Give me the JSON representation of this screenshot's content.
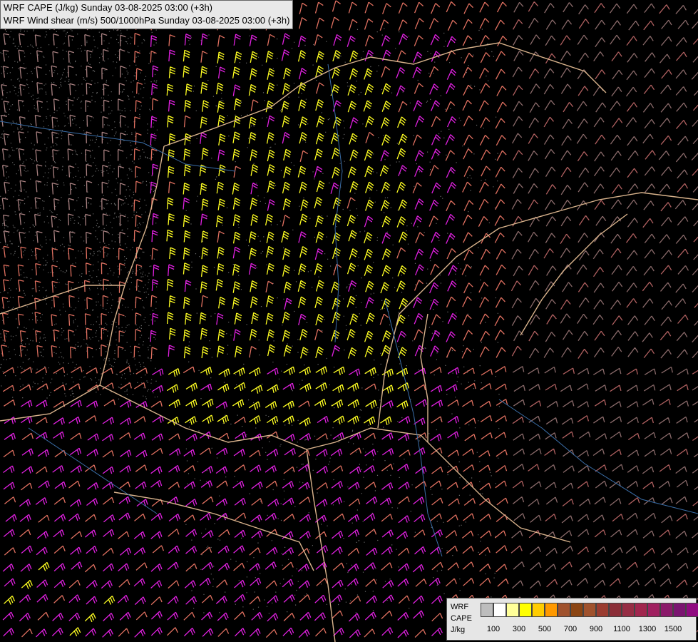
{
  "title": {
    "line1": "WRF CAPE (J/kg) Sunday 03-08-2025 03:00 (+3h)",
    "line2": "WRF Wind shear (m/s) 500/1000hPa Sunday 03-08-2025 03:00 (+3h)"
  },
  "legend": {
    "label_top": "WRF",
    "label_mid": "CAPE",
    "label_unit": "J/kg",
    "colors": [
      "#bdbdbd",
      "#ffffff",
      "#ffff99",
      "#ffff00",
      "#ffcc00",
      "#ff9900",
      "#a0522d",
      "#8b4513",
      "#a0522d",
      "#9a3c30",
      "#8b2e38",
      "#962d44",
      "#a1264e",
      "#a02060",
      "#8b1a6a",
      "#7a1470",
      "#900a80",
      "#c000c0"
    ],
    "ticks": [
      "100",
      "300",
      "500",
      "700",
      "900",
      "1100",
      "1300",
      "1500"
    ]
  }
}
